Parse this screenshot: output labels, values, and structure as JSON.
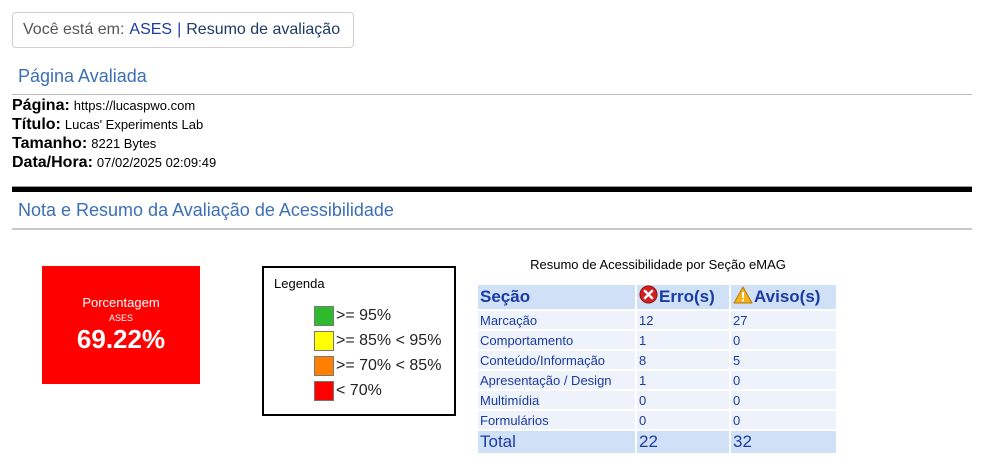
{
  "breadcrumb": {
    "prefix": "Você está em:",
    "home_link": "ASES",
    "separator": "|",
    "current": "Resumo de avaliação"
  },
  "evaluated_page": {
    "heading": "Página Avaliada",
    "fields": [
      {
        "label": "Página:",
        "value": "https://lucaspwo.com"
      },
      {
        "label": "Título:",
        "value": "Lucas' Experiments Lab"
      },
      {
        "label": "Tamanho:",
        "value": "8221 Bytes"
      },
      {
        "label": "Data/Hora:",
        "value": "07/02/2025 02:09:49"
      }
    ]
  },
  "summary_section": {
    "heading": "Nota e Resumo da Avaliação de Acessibilidade"
  },
  "score": {
    "label": "Porcentagem",
    "sub_label": "ASES",
    "value": "69.22%",
    "color": "#ff0000"
  },
  "legend": {
    "title": "Legenda",
    "items": [
      {
        "label": ">= 95%",
        "color": "#2dbb2d"
      },
      {
        "label": ">= 85% < 95%",
        "color": "#ffff00"
      },
      {
        "label": ">= 70% < 85%",
        "color": "#ff7f00"
      },
      {
        "label": "< 70%",
        "color": "#ff0000"
      }
    ]
  },
  "emag_table": {
    "caption": "Resumo de Acessibilidade por Seção eMAG",
    "headers": {
      "section": "Seção",
      "errors": "Erro(s)",
      "warnings": "Aviso(s)"
    },
    "header_icons": {
      "errors": "error-icon",
      "warnings": "warning-icon"
    },
    "rows": [
      {
        "section": "Marcação",
        "errors": "12",
        "warnings": "27"
      },
      {
        "section": "Comportamento",
        "errors": "1",
        "warnings": "0"
      },
      {
        "section": "Conteúdo/Informação",
        "errors": "8",
        "warnings": "5"
      },
      {
        "section": "Apresentação / Design",
        "errors": "1",
        "warnings": "0"
      },
      {
        "section": "Multimídia",
        "errors": "0",
        "warnings": "0"
      },
      {
        "section": "Formulários",
        "errors": "0",
        "warnings": "0"
      }
    ],
    "total": {
      "section": "Total",
      "errors": "22",
      "warnings": "32"
    }
  }
}
